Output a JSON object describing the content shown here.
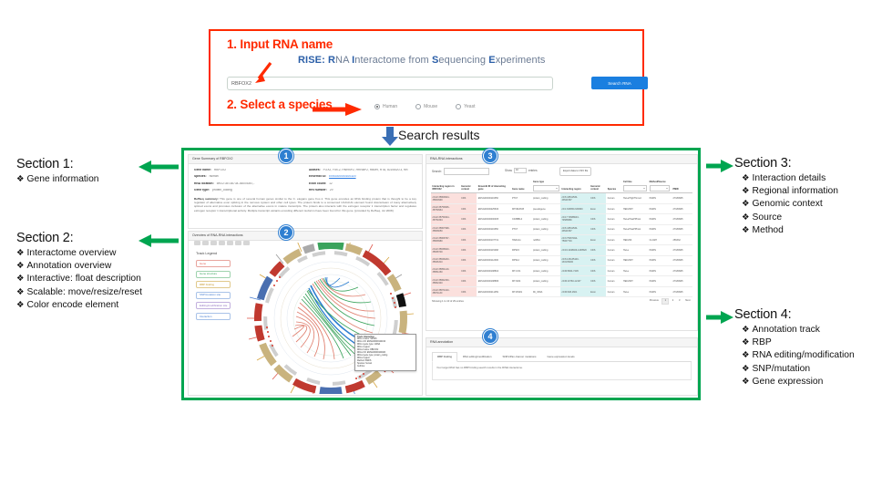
{
  "search_panel": {
    "step1": "1. Input RNA name",
    "step2": "2. Select a species",
    "title_lead": "RISE:",
    "title_r1": "R",
    "title_w1": "NA ",
    "title_r2": "I",
    "title_w2": "nteractome from ",
    "title_r3": "S",
    "title_w3": "equencing ",
    "title_r4": "E",
    "title_w4": "xperiments",
    "input_value": "RBFOX2",
    "input_placeholder": "Input RNA name",
    "search_button": "Search RNA",
    "species": [
      {
        "label": "Human",
        "selected": true
      },
      {
        "label": "Mouse",
        "selected": false
      },
      {
        "label": "Yeast",
        "selected": false
      }
    ]
  },
  "results_label": "Search results",
  "badges": {
    "one": "1",
    "two": "2",
    "three": "3",
    "four": "4"
  },
  "gene_summary": {
    "header": "Gene Summary of RBFOX2",
    "fields": [
      {
        "key": "Gene name:",
        "value": "RBFOX2"
      },
      {
        "key": "Aliases:",
        "value": "FOX2, Fox-2, HNRBP2, HRNBP2, RBM9, RTA, dJ106I20.3, fxh"
      },
      {
        "key": "Species:",
        "value": "human"
      },
      {
        "key": "Ensembl ID:",
        "value": "ENSG00000100320",
        "link": true
      },
      {
        "key": "RNA location:",
        "value": "chr22:35738734-36004087,-"
      },
      {
        "key": "Exon count:",
        "value": "12"
      },
      {
        "key": "Gene type:",
        "value": "protein_coding"
      },
      {
        "key": "RRI number:",
        "value": "29"
      }
    ],
    "summary_label": "RefSeq summary:",
    "summary_text": "This gene is one of several human genes similar to the C. elegans gene Fox-1. This gene encodes an RNA binding protein that is thought to be a key regulator of alternative exon splicing in the nervous system and other cell types. The protein binds to a conserved UGCAUG element found downstream of many alternatively spliced exons and promotes inclusion of the alternative exons in mature transcripts. The protein also interacts with the estrogen receptor 1 transcription factor and regulates estrogen receptor 1 transcriptional activity. Multiple transcript variants encoding different isoforms have been found for this gene. [provided by RefSeq, Jul 2008]"
  },
  "overview": {
    "header": "Overview of RNA-RNA interactions",
    "legend_title": "Track Legend",
    "legend_items": [
      {
        "label": "Gene",
        "color": "#e05a4e"
      },
      {
        "label": "Gene structure",
        "color": "#3aa35c"
      },
      {
        "label": "RBP binding",
        "color": "#d6a540"
      },
      {
        "label": "SNP/mutation site",
        "color": "#4a7fd1"
      },
      {
        "label": "Editing/modification site",
        "color": "#8f6fc0"
      },
      {
        "label": "Interaction",
        "color": "#4a7fd1"
      }
    ],
    "tooltip": {
      "title": "Track: Interaction",
      "lines": [
        "RNA-1 name: SRSF6",
        "RNA-1 ID: ENSG00000124193",
        "RNA-1 gene type: mRNA",
        "RNA-1 region:",
        "RNA-2 name: RBFOX2",
        "RNA-2 ID: ENSG00000100320",
        "RNA-2 gene type: protein_coding",
        "RNA-2 region:",
        "Method: PARIS",
        "Species: human",
        "Cell line:"
      ]
    }
  },
  "interactions": {
    "header": "RNA-RNA interactions",
    "search_label": "Search:",
    "show_label": "Show",
    "show_value": "10",
    "entries_label": "entries",
    "export_label": "Export data to CSV file",
    "columns": [
      "Interacting region in RBFOX2",
      "Genomic context",
      "Ensembl ID of interacting gene",
      "Gene name",
      "Gene type",
      "Interacting region",
      "Genomic context",
      "Species",
      "Cell line",
      "Method/Source",
      "PMID"
    ],
    "filter_columns": [
      4,
      8,
      9
    ],
    "rows": [
      [
        "chr22:35809944-35809990",
        "CDS",
        "ENSG00000116350",
        "PTK7",
        "protein_coding",
        "chr6:43541530-43541567",
        "CDS",
        "human",
        "HeLa/HighThroud",
        "PARIS",
        "27180905"
      ],
      [
        "chr22:35759936-35759964",
        "CDS",
        "ENSG00000225630",
        "MTND2P28",
        "pseudogene",
        "chr1:630650-630660",
        "Exon",
        "human",
        "HEK293T",
        "PARIS",
        "27180905"
      ],
      [
        "chr22:35759324-35759394",
        "CDS",
        "ENSG00000000005",
        "CD3BBL0",
        "protein_coding",
        "chr17:74588643-74588680",
        "CDS",
        "human",
        "HeLa/HuaPPhost",
        "PARIS",
        "27180905"
      ],
      [
        "chr22:35807998-35808050",
        "CDS",
        "ENSG00000116350",
        "PTK7",
        "protein_coding",
        "chr6:43541530-43541567",
        "CDS",
        "human",
        "HeLa/HuaPPhost",
        "PARIS",
        "27180905"
      ],
      [
        "chr22:35808797-35808980",
        "CDS",
        "ENSG00000107731",
        "HAR1An",
        "ncRNA",
        "chr3:75067494-75067716",
        "Exon",
        "human",
        "HEK293",
        "CLASH",
        "256332"
      ],
      [
        "chr22:35838620-35838700",
        "CDS",
        "ENSG00000115268",
        "RPS15",
        "protein_coding",
        "chr19:1438406-1438520",
        "CDS",
        "human",
        "HeLa",
        "PARIS",
        "27180905"
      ],
      [
        "chr22:35846200-35846310",
        "CDS",
        "ENSG00000112306",
        "RPS12",
        "protein_coding",
        "chr6:133135100-133135200",
        "CDS",
        "human",
        "HEK293T",
        "PARIS",
        "27180905"
      ],
      [
        "chr22:35851140-35851260",
        "CDS",
        "ENSG00000198804",
        "MT-CO1",
        "protein_coding",
        "chrM:5904-7445",
        "CDS",
        "human",
        "HeLa",
        "PARIS",
        "27180905"
      ],
      [
        "chr22:35862330-35862440",
        "CDS",
        "ENSG00000198886",
        "MT-ND4",
        "protein_coding",
        "chrM:10760-12137",
        "CDS",
        "human",
        "HEK293T",
        "PARIS",
        "27180905"
      ],
      [
        "chr22:35871020-35871130",
        "CDS",
        "ENSG00000211459",
        "MT-RNR1",
        "Mt_rRNA",
        "chrM:648-1601",
        "Exon",
        "human",
        "HeLa",
        "PARIS",
        "27180905"
      ]
    ],
    "showing_text": "Showing 1 to 10 of 29 entries",
    "pager": {
      "previous": "Previous",
      "pages": [
        "1",
        "2",
        "3"
      ],
      "next": "Next",
      "active": "1"
    }
  },
  "annotation": {
    "header": "RNA annotation",
    "tabs": [
      {
        "label": "RBP binding",
        "active": true
      },
      {
        "label": "RNA editing/modification",
        "active": false
      },
      {
        "label": "SNPs/Pan-Cancer mutations",
        "active": false
      },
      {
        "label": "Gene expression levels",
        "active": false
      }
    ],
    "empty_message": "Your target RNA has no RBP binding search results in the RISE interactome."
  },
  "sections": [
    {
      "id": "section-1",
      "title": "Section 1:",
      "items": [
        "Gene information"
      ]
    },
    {
      "id": "section-2",
      "title": "Section 2:",
      "items": [
        "Interactome overview",
        "Annotation overview",
        "Interactive: float description",
        "Scalable: move/resize/reset",
        "Color encode element"
      ]
    },
    {
      "id": "section-3",
      "title": "Section 3:",
      "items": [
        "Interaction details",
        "Regional information",
        "Genomic context",
        "Source",
        "Method"
      ]
    },
    {
      "id": "section-4",
      "title": "Section 4:",
      "items": [
        "Annotation track",
        "RBP",
        "RNA editing/modification",
        "SNP/mutation",
        "Gene expression"
      ]
    }
  ],
  "colors": {
    "red_box": "#ff2a00",
    "green_box": "#00a550",
    "badge_blue": "#2f7fd1",
    "button_blue": "#1a7fe0",
    "row_pink": "#fbe0dd",
    "row_cyan": "#d8f2f2"
  }
}
